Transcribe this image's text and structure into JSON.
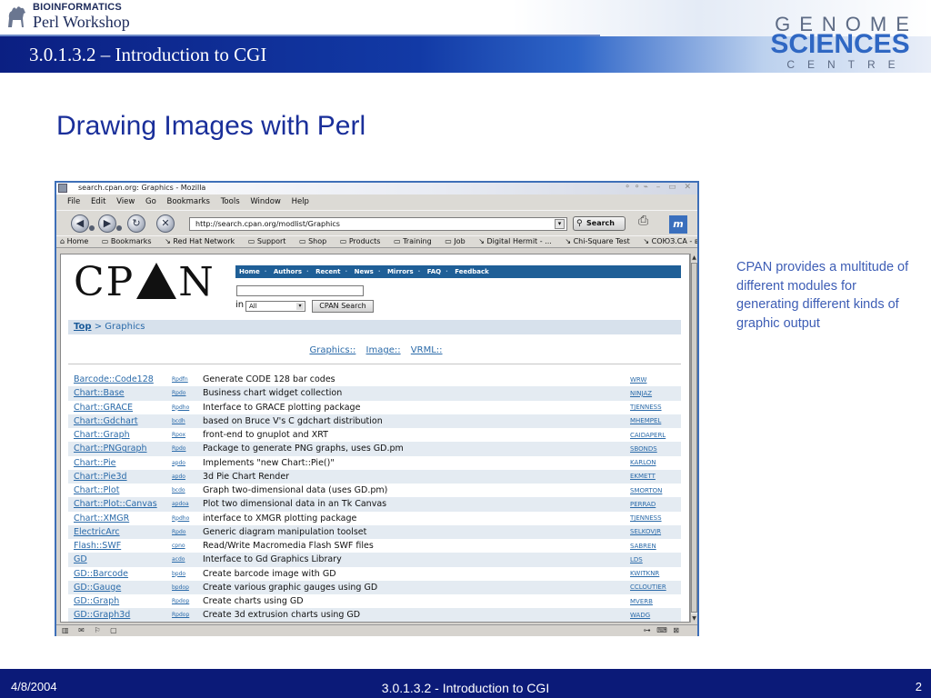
{
  "slide": {
    "logo_line1": "BIOINFORMATICS",
    "logo_line2": "Perl Workshop",
    "header_title": "3.0.1.3.2 – Introduction to CGI",
    "brand": {
      "genome": "GENOME",
      "sciences": "SCIENCES",
      "centre": "CENTRE"
    },
    "title": "Drawing Images with Perl",
    "side_note": "CPAN provides a multitude of different modules for generating different kinds of graphic output",
    "footer": {
      "date": "4/8/2004",
      "center": "3.0.1.3.2 - Introduction to CGI",
      "page": "2"
    }
  },
  "browser": {
    "window_title": "search.cpan.org: Graphics - Mozilla",
    "menu": [
      "File",
      "Edit",
      "View",
      "Go",
      "Bookmarks",
      "Tools",
      "Window",
      "Help"
    ],
    "url": "http://search.cpan.org/modlist/Graphics",
    "search_label": "Search",
    "bookmarks": [
      "Home",
      "Bookmarks",
      "Red Hat Network",
      "Support",
      "Shop",
      "Products",
      "Training",
      "Job",
      "Digital Hermit - ...",
      "Chi-Square Test",
      "СОЮЗ.СА - вс..."
    ]
  },
  "cpan": {
    "nav": [
      "Home",
      "Authors",
      "Recent",
      "News",
      "Mirrors",
      "FAQ",
      "Feedback"
    ],
    "in_label": "in",
    "select_value": "All",
    "search_button": "CPAN Search",
    "crumb_top": "Top",
    "crumb_rest": "> Graphics",
    "categories": [
      "Graphics::",
      "Image::",
      "VRML::"
    ],
    "modules": [
      {
        "name": "Barcode::Code128",
        "dsli": "Rpdfn",
        "desc": "Generate CODE 128 bar codes",
        "author": "WRW"
      },
      {
        "name": "Chart::Base",
        "dsli": "Rpdo",
        "desc": "Business chart widget collection",
        "author": "NINJAZ"
      },
      {
        "name": "Chart::GRACE",
        "dsli": "Rpdho",
        "desc": "Interface to GRACE plotting package",
        "author": "TJENNESS"
      },
      {
        "name": "Chart::Gdchart",
        "dsli": "bcdh",
        "desc": "based on Bruce V's C gdchart distribution",
        "author": "MHEMPEL"
      },
      {
        "name": "Chart::Graph",
        "dsli": "Rpox",
        "desc": "front-end to gnuplot and XRT",
        "author": "CAIDAPERL"
      },
      {
        "name": "Chart::PNGgraph",
        "dsli": "Rpdo",
        "desc": "Package to generate PNG graphs, uses GD.pm",
        "author": "SBONDS"
      },
      {
        "name": "Chart::Pie",
        "dsli": "apdo",
        "desc": "Implements \"new Chart::Pie()\"",
        "author": "KARLON"
      },
      {
        "name": "Chart::Pie3d",
        "dsli": "apdo",
        "desc": "3d Pie Chart Render",
        "author": "EKMETT"
      },
      {
        "name": "Chart::Plot",
        "dsli": "bcdo",
        "desc": "Graph two-dimensional data (uses GD.pm)",
        "author": "SMORTON"
      },
      {
        "name": "Chart::Plot::Canvas",
        "dsli": "apdoa",
        "desc": "Plot two dimensional data in an Tk Canvas",
        "author": "PERRAD"
      },
      {
        "name": "Chart::XMGR",
        "dsli": "Rpdho",
        "desc": "interface to XMGR plotting package",
        "author": "TJENNESS"
      },
      {
        "name": "ElectricArc",
        "dsli": "Rpdo",
        "desc": "Generic diagram manipulation toolset",
        "author": "SELKOVJR"
      },
      {
        "name": "Flash::SWF",
        "dsli": "cpno",
        "desc": "Read/Write Macromedia Flash SWF files",
        "author": "SABREN"
      },
      {
        "name": "GD",
        "dsli": "acdo",
        "desc": "Interface to Gd Graphics Library",
        "author": "LDS"
      },
      {
        "name": "GD::Barcode",
        "dsli": "bpdo",
        "desc": "Create barcode image with GD",
        "author": "KWITKNR"
      },
      {
        "name": "GD::Gauge",
        "dsli": "bpdop",
        "desc": "Create various graphic gauges using GD",
        "author": "CCLOUTIER"
      },
      {
        "name": "GD::Graph",
        "dsli": "Rpdop",
        "desc": "Create charts using GD",
        "author": "MVERB"
      },
      {
        "name": "GD::Graph3d",
        "dsli": "Rpdop",
        "desc": "Create 3d extrusion charts using GD",
        "author": "WADG"
      }
    ]
  }
}
